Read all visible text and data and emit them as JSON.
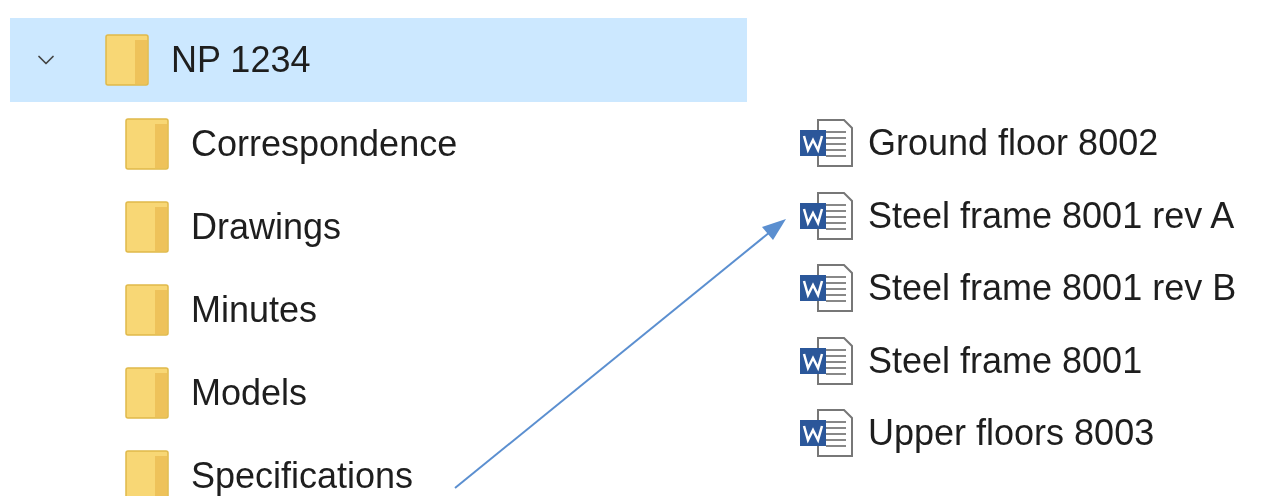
{
  "tree": [
    {
      "label": "NP 1234",
      "selected": true,
      "expanded": true,
      "children": [
        {
          "label": "Correspondence",
          "selected": false
        },
        {
          "label": "Drawings",
          "selected": false
        },
        {
          "label": "Minutes",
          "selected": false
        },
        {
          "label": "Models",
          "selected": false
        },
        {
          "label": "Specifications",
          "selected": false
        }
      ]
    }
  ],
  "files": [
    {
      "name": "Ground floor 8002"
    },
    {
      "name": "Steel frame 8001 rev A"
    },
    {
      "name": "Steel frame 8001 rev B"
    },
    {
      "name": "Steel frame 8001"
    },
    {
      "name": "Upper floors 8003"
    }
  ]
}
